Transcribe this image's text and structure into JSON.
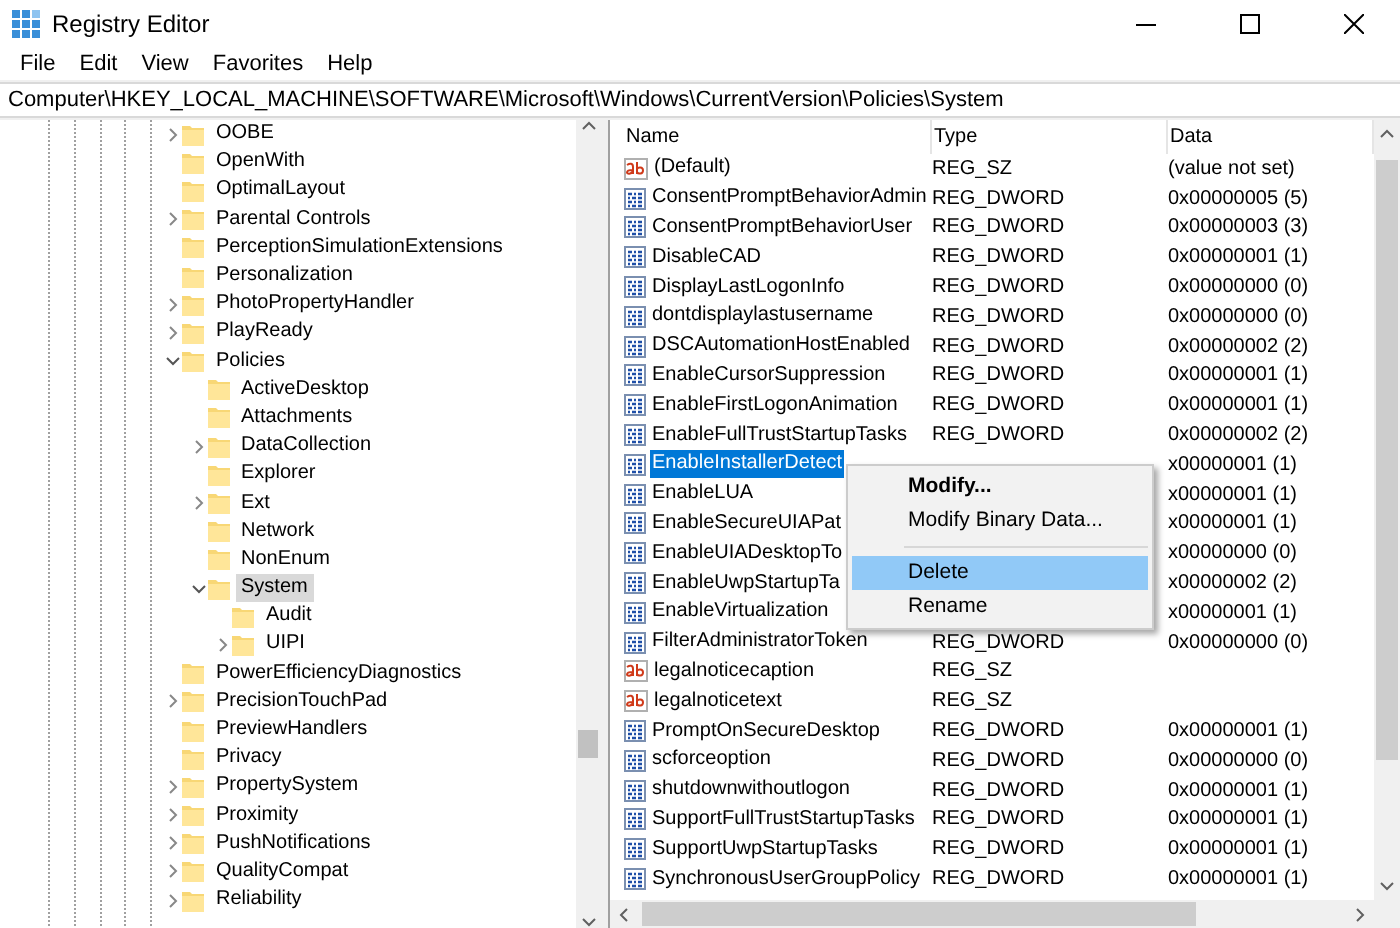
{
  "window": {
    "title": "Registry Editor"
  },
  "menu_bar": [
    "File",
    "Edit",
    "View",
    "Favorites",
    "Help"
  ],
  "address": "Computer\\HKEY_LOCAL_MACHINE\\SOFTWARE\\Microsoft\\Windows\\CurrentVersion\\Policies\\System",
  "tree": {
    "items": [
      {
        "label": "OOBE",
        "kind": "branch",
        "expanded": false,
        "selected": false
      },
      {
        "label": "OpenWith",
        "kind": "leaf",
        "expanded": false,
        "selected": false
      },
      {
        "label": "OptimalLayout",
        "kind": "leaf",
        "expanded": false,
        "selected": false
      },
      {
        "label": "Parental Controls",
        "kind": "branch",
        "expanded": false,
        "selected": false
      },
      {
        "label": "PerceptionSimulationExtensions",
        "kind": "leaf",
        "expanded": false,
        "selected": false
      },
      {
        "label": "Personalization",
        "kind": "leaf",
        "expanded": false,
        "selected": false
      },
      {
        "label": "PhotoPropertyHandler",
        "kind": "branch",
        "expanded": false,
        "selected": false
      },
      {
        "label": "PlayReady",
        "kind": "branch",
        "expanded": false,
        "selected": false
      },
      {
        "label": "Policies",
        "kind": "branch",
        "expanded": true,
        "selected": false,
        "children": [
          {
            "label": "ActiveDesktop",
            "kind": "leaf",
            "expanded": false,
            "selected": false
          },
          {
            "label": "Attachments",
            "kind": "leaf",
            "expanded": false,
            "selected": false
          },
          {
            "label": "DataCollection",
            "kind": "branch",
            "expanded": false,
            "selected": false
          },
          {
            "label": "Explorer",
            "kind": "leaf",
            "expanded": false,
            "selected": false
          },
          {
            "label": "Ext",
            "kind": "branch",
            "expanded": false,
            "selected": false
          },
          {
            "label": "Network",
            "kind": "leaf",
            "expanded": false,
            "selected": false
          },
          {
            "label": "NonEnum",
            "kind": "leaf",
            "expanded": false,
            "selected": false
          },
          {
            "label": "System",
            "kind": "branch",
            "expanded": true,
            "selected": true,
            "children": [
              {
                "label": "Audit",
                "kind": "leaf",
                "expanded": false,
                "selected": false
              },
              {
                "label": "UIPI",
                "kind": "branch",
                "expanded": false,
                "selected": false
              }
            ]
          }
        ]
      },
      {
        "label": "PowerEfficiencyDiagnostics",
        "kind": "leaf",
        "expanded": false,
        "selected": false
      },
      {
        "label": "PrecisionTouchPad",
        "kind": "branch",
        "expanded": false,
        "selected": false
      },
      {
        "label": "PreviewHandlers",
        "kind": "leaf",
        "expanded": false,
        "selected": false
      },
      {
        "label": "Privacy",
        "kind": "leaf",
        "expanded": false,
        "selected": false
      },
      {
        "label": "PropertySystem",
        "kind": "branch",
        "expanded": false,
        "selected": false
      },
      {
        "label": "Proximity",
        "kind": "branch",
        "expanded": false,
        "selected": false
      },
      {
        "label": "PushNotifications",
        "kind": "branch",
        "expanded": false,
        "selected": false
      },
      {
        "label": "QualityCompat",
        "kind": "branch",
        "expanded": false,
        "selected": false
      },
      {
        "label": "Reliability",
        "kind": "branch",
        "expanded": false,
        "selected": false
      }
    ]
  },
  "values": {
    "columns": [
      "Name",
      "Type",
      "Data"
    ],
    "rows": [
      {
        "kind": "string",
        "name": "(Default)",
        "type": "REG_SZ",
        "data": "(value not set)",
        "selected": false
      },
      {
        "kind": "dword",
        "name": "ConsentPromptBehaviorAdmin",
        "type": "REG_DWORD",
        "data": "0x00000005 (5)",
        "selected": false
      },
      {
        "kind": "dword",
        "name": "ConsentPromptBehaviorUser",
        "type": "REG_DWORD",
        "data": "0x00000003 (3)",
        "selected": false
      },
      {
        "kind": "dword",
        "name": "DisableCAD",
        "type": "REG_DWORD",
        "data": "0x00000001 (1)",
        "selected": false
      },
      {
        "kind": "dword",
        "name": "DisplayLastLogonInfo",
        "type": "REG_DWORD",
        "data": "0x00000000 (0)",
        "selected": false
      },
      {
        "kind": "dword",
        "name": "dontdisplaylastusername",
        "type": "REG_DWORD",
        "data": "0x00000000 (0)",
        "selected": false
      },
      {
        "kind": "dword",
        "name": "DSCAutomationHostEnabled",
        "type": "REG_DWORD",
        "data": "0x00000002 (2)",
        "selected": false
      },
      {
        "kind": "dword",
        "name": "EnableCursorSuppression",
        "type": "REG_DWORD",
        "data": "0x00000001 (1)",
        "selected": false
      },
      {
        "kind": "dword",
        "name": "EnableFirstLogonAnimation",
        "type": "REG_DWORD",
        "data": "0x00000001 (1)",
        "selected": false
      },
      {
        "kind": "dword",
        "name": "EnableFullTrustStartupTasks",
        "type": "REG_DWORD",
        "data": "0x00000002 (2)",
        "selected": false
      },
      {
        "kind": "dword",
        "name": "EnableInstallerDetect",
        "data": "x00000001 (1)",
        "selected": true
      },
      {
        "kind": "dword",
        "name": "EnableLUA",
        "data": "x00000001 (1)",
        "selected": false
      },
      {
        "kind": "dword",
        "name": "EnableSecureUIAPat",
        "data": "x00000001 (1)",
        "selected": false
      },
      {
        "kind": "dword",
        "name": "EnableUIADesktopTo",
        "data": "x00000000 (0)",
        "selected": false
      },
      {
        "kind": "dword",
        "name": "EnableUwpStartupTa",
        "data": "x00000002 (2)",
        "selected": false
      },
      {
        "kind": "dword",
        "name": "EnableVirtualization",
        "data": "x00000001 (1)",
        "selected": false
      },
      {
        "kind": "dword",
        "name": "FilterAdministratorToken",
        "type": "REG_DWORD",
        "data": "0x00000000 (0)",
        "selected": false
      },
      {
        "kind": "string",
        "name": "legalnoticecaption",
        "type": "REG_SZ",
        "selected": false
      },
      {
        "kind": "string",
        "name": "legalnoticetext",
        "type": "REG_SZ",
        "selected": false
      },
      {
        "kind": "dword",
        "name": "PromptOnSecureDesktop",
        "type": "REG_DWORD",
        "data": "0x00000001 (1)",
        "selected": false
      },
      {
        "kind": "dword",
        "name": "scforceoption",
        "type": "REG_DWORD",
        "data": "0x00000000 (0)",
        "selected": false
      },
      {
        "kind": "dword",
        "name": "shutdownwithoutlogon",
        "type": "REG_DWORD",
        "data": "0x00000001 (1)",
        "selected": false
      },
      {
        "kind": "dword",
        "name": "SupportFullTrustStartupTasks",
        "type": "REG_DWORD",
        "data": "0x00000001 (1)",
        "selected": false
      },
      {
        "kind": "dword",
        "name": "SupportUwpStartupTasks",
        "type": "REG_DWORD",
        "data": "0x00000001 (1)",
        "selected": false
      },
      {
        "kind": "dword",
        "name": "SynchronousUserGroupPolicy",
        "type": "REG_DWORD",
        "data": "0x00000001 (1)",
        "selected": false
      }
    ]
  },
  "context_menu": {
    "items": [
      {
        "kind": "item",
        "label": "Modify...",
        "default": true,
        "selected": false
      },
      {
        "kind": "item",
        "label": "Modify Binary Data...",
        "default": false,
        "selected": false
      },
      {
        "kind": "separator"
      },
      {
        "kind": "item",
        "label": "Delete",
        "default": false,
        "selected": true
      },
      {
        "kind": "item",
        "label": "Rename",
        "default": false,
        "selected": false
      }
    ]
  }
}
